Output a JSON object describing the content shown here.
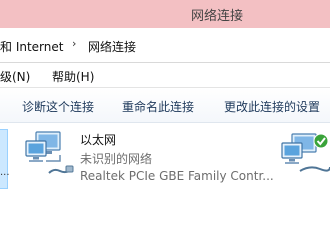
{
  "window": {
    "title": "网络连接"
  },
  "address": {
    "parent": "和 Internet",
    "separator": "›",
    "current": "网络连接"
  },
  "menu": {
    "items": [
      {
        "label": "高级(N)"
      },
      {
        "label": "帮助(H)"
      }
    ]
  },
  "toolbar": {
    "diagnose_label": "诊断这个连接",
    "rename_label": "重命名此连接",
    "change_settings_label": "更改此连接的设置"
  },
  "connections": [
    {
      "name": "以太网",
      "status": "未识别的网络",
      "adapter": "Realtek PCIe GBE Family Contr...",
      "icon": "network-adapter-icon"
    },
    {
      "icon": "network-adapter-connected-icon"
    }
  ],
  "partial_left_item": {
    "text": "..."
  },
  "colors": {
    "titlebar_bg": "#f3c0c3",
    "selection_bg": "#cce8ff",
    "toolbar_text": "#1e395b",
    "status_text": "#6d6d6d",
    "check_badge": "#3aa33a"
  }
}
